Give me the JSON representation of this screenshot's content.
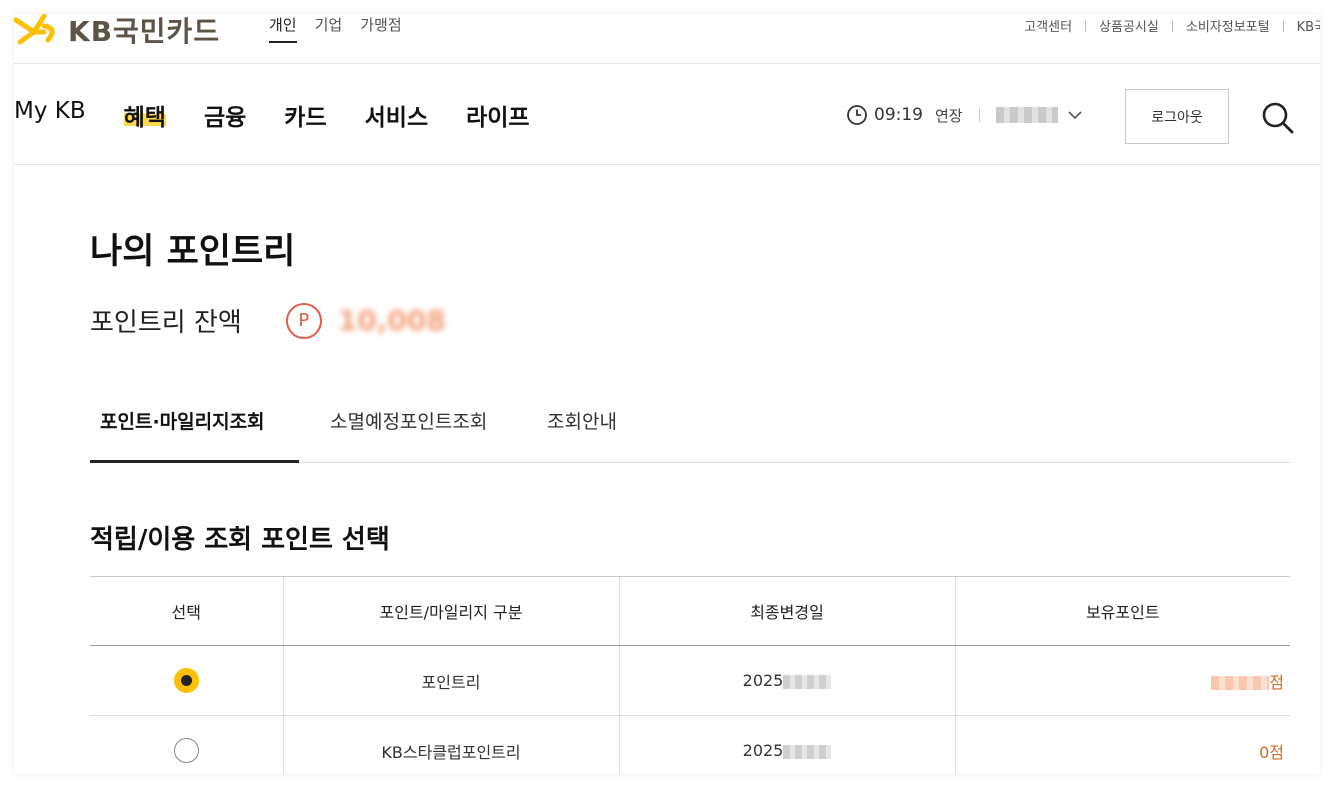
{
  "brand": {
    "logo_text": "KB국민카드",
    "accent": "#fdc000"
  },
  "utility": {
    "segments": [
      {
        "label": "개인",
        "active": true
      },
      {
        "label": "기업",
        "active": false
      },
      {
        "label": "가맹점",
        "active": false
      }
    ],
    "links": [
      "고객센터",
      "상품공시실",
      "소비자정보포털",
      "KB국"
    ]
  },
  "nav": {
    "items": [
      "My KB",
      "혜택",
      "금융",
      "카드",
      "서비스",
      "라이프"
    ],
    "highlight_index": 1,
    "session_time": "09:19",
    "extend_label": "연장",
    "logout_label": "로그아웃",
    "icons": {
      "clock": "clock-icon",
      "search": "search-icon",
      "dropdown": "chevron-down-icon"
    }
  },
  "page": {
    "title": "나의 포인트리",
    "balance_label": "포인트리 잔액",
    "balance_badge": "P",
    "balance_value": "10,008",
    "tabs": [
      {
        "label": "포인트·마일리지조회",
        "active": true
      },
      {
        "label": "소멸예정포인트조회",
        "active": false
      },
      {
        "label": "조회안내",
        "active": false
      }
    ],
    "section_title": "적립/이용 조회 포인트 선택"
  },
  "table": {
    "headers": [
      "선택",
      "포인트/마일리지 구분",
      "최종변경일",
      "보유포인트"
    ],
    "rows": [
      {
        "selected": true,
        "name": "포인트리",
        "date_prefix": "2025",
        "points_suffix": "점",
        "points_masked": true
      },
      {
        "selected": false,
        "name": "KB스타클럽포인트리",
        "date_prefix": "2025",
        "points": "0점",
        "points_masked": false
      }
    ],
    "points_color": "#d86a1e"
  }
}
